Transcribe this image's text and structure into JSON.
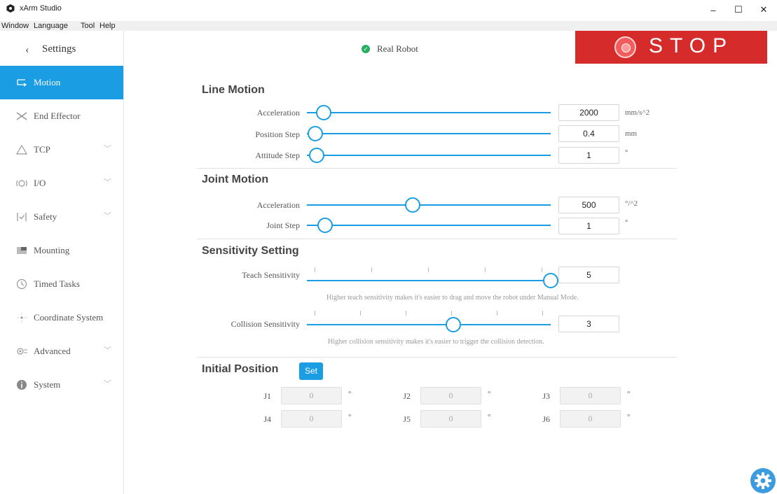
{
  "window": {
    "title": "xArm Studio",
    "menu": [
      "Window",
      "Language",
      "Tool",
      "Help"
    ],
    "controls": {
      "minimize": "–",
      "maximize": "☐",
      "close": "✕"
    }
  },
  "sidebar": {
    "back_icon": "‹",
    "title": "Settings",
    "items": [
      {
        "label": "Motion",
        "icon": "motion-icon",
        "active": true,
        "chevron": ""
      },
      {
        "label": "End Effector",
        "icon": "gripper-icon",
        "chevron": ""
      },
      {
        "label": "TCP",
        "icon": "tcp-icon",
        "chevron": "﹀"
      },
      {
        "label": "I/O",
        "icon": "io-icon",
        "chevron": "﹀"
      },
      {
        "label": "Safety",
        "icon": "shield-icon",
        "chevron": "﹀"
      },
      {
        "label": "Mounting",
        "icon": "mounting-icon",
        "chevron": ""
      },
      {
        "label": "Timed Tasks",
        "icon": "clock-icon",
        "chevron": ""
      },
      {
        "label": "Coordinate System",
        "icon": "coordinate-icon",
        "chevron": ""
      },
      {
        "label": "Advanced",
        "icon": "advanced-icon",
        "chevron": "﹀"
      },
      {
        "label": "System",
        "icon": "info-icon",
        "chevron": "﹀"
      }
    ]
  },
  "status": {
    "text": "Real Robot",
    "color": "#27ae60"
  },
  "stop": {
    "label": "STOP",
    "color": "#d52b2b"
  },
  "line_motion": {
    "title": "Line Motion",
    "rows": [
      {
        "label": "Acceleration",
        "value": "2000",
        "unit": "mm/s^2",
        "level": 0.07
      },
      {
        "label": "Position Step",
        "value": "0.4",
        "unit": "mm",
        "level": 0.035
      },
      {
        "label": "Attitude Step",
        "value": "1",
        "unit": "°",
        "level": 0.04
      }
    ]
  },
  "joint_motion": {
    "title": "Joint Motion",
    "rows": [
      {
        "label": "Acceleration",
        "value": "500",
        "unit": "°/^2",
        "level": 0.435
      },
      {
        "label": "Joint Step",
        "value": "1",
        "unit": "°",
        "level": 0.075
      }
    ]
  },
  "sensitivity": {
    "title": "Sensitivity Setting",
    "teach": {
      "label": "Teach Sensitivity",
      "value": "5",
      "level": 1.0,
      "hint": "Higher teach sensitivity makes it's easier to drag and move the robot under Manual Mode."
    },
    "collision": {
      "label": "Collision Sensitivity",
      "value": "3",
      "level": 0.6,
      "hint": "Higher collision sensitivity makes it's easier to trigger the collision detection."
    }
  },
  "initial_position": {
    "title": "Initial Position",
    "set_label": "Set",
    "joints": [
      {
        "label": "J1",
        "value": "0",
        "unit": "°"
      },
      {
        "label": "J2",
        "value": "0",
        "unit": "°"
      },
      {
        "label": "J3",
        "value": "0",
        "unit": "°"
      },
      {
        "label": "J4",
        "value": "0",
        "unit": "°"
      },
      {
        "label": "J5",
        "value": "0",
        "unit": "°"
      },
      {
        "label": "J6",
        "value": "0",
        "unit": "°"
      }
    ]
  },
  "accent_color": "#1b9de4"
}
